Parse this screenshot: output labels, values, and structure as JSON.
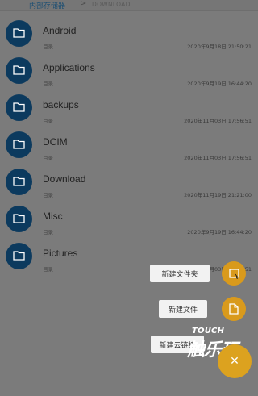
{
  "breadcrumb": {
    "home": "内部存储器",
    "separator": ">",
    "current": "DOWNLOAD"
  },
  "files": [
    {
      "name": "Android",
      "type": "目录",
      "date": "2020年9月18日 21:50:21"
    },
    {
      "name": "Applications",
      "type": "目录",
      "date": "2020年9月19日 16:44:20"
    },
    {
      "name": "backups",
      "type": "目录",
      "date": "2020年11月03日 17:56:51"
    },
    {
      "name": "DCIM",
      "type": "目录",
      "date": "2020年11月03日 17:56:51"
    },
    {
      "name": "Download",
      "type": "目录",
      "date": "2020年11月19日 21:21:00"
    },
    {
      "name": "Misc",
      "type": "目录",
      "date": "2020年9月19日 16:44:20"
    },
    {
      "name": "Pictures",
      "type": "目录",
      "date": "2020年11月03日 17:56:51"
    }
  ],
  "fab_menu": {
    "new_folder": "新建文件夹",
    "new_file": "新建文件",
    "new_link": "新建云链接",
    "fab_icon": "close-icon"
  },
  "watermark": {
    "line1": "TOUCH",
    "line2": "触乐玩"
  },
  "colors": {
    "folder": "#0c3a5e",
    "accent": "#dca21f",
    "overlay": "#7b7b7b"
  }
}
